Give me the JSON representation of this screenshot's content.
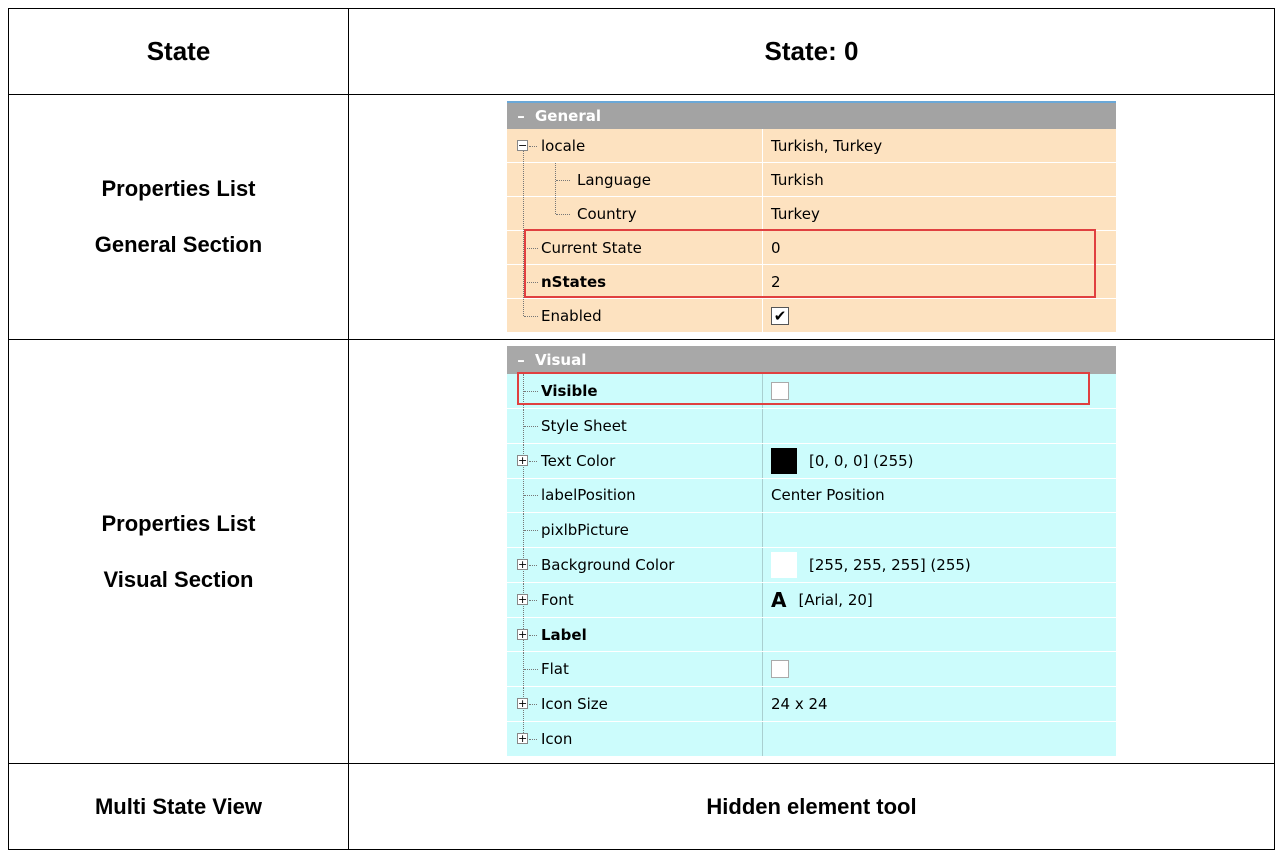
{
  "header": {
    "left": "State",
    "right": "State: 0"
  },
  "rows": [
    {
      "label_line1": "Properties List",
      "label_line2": "General Section"
    },
    {
      "label_line1": "Properties List",
      "label_line2": "Visual Section"
    }
  ],
  "footer": {
    "left": "Multi State View",
    "right": "Hidden element tool"
  },
  "general": {
    "title": "General",
    "items": [
      {
        "name": "locale",
        "value": "Turkish, Turkey"
      },
      {
        "name": "Language",
        "value": "Turkish"
      },
      {
        "name": "Country",
        "value": "Turkey"
      },
      {
        "name": "Current State",
        "value": "0"
      },
      {
        "name": "nStates",
        "value": "2"
      },
      {
        "name": "Enabled",
        "value": "",
        "checked": true
      }
    ]
  },
  "visual": {
    "title": "Visual",
    "items": [
      {
        "name": "Visible",
        "value": "",
        "checked": false
      },
      {
        "name": "Style Sheet",
        "value": ""
      },
      {
        "name": "Text Color",
        "value": "[0, 0, 0] (255)",
        "swatch": "#000000"
      },
      {
        "name": "labelPosition",
        "value": "Center Position"
      },
      {
        "name": "pixlbPicture",
        "value": ""
      },
      {
        "name": "Background Color",
        "value": "[255, 255, 255] (255)",
        "swatch": "#ffffff"
      },
      {
        "name": "Font",
        "value": "[Arial, 20]",
        "glyph": "A"
      },
      {
        "name": "Label",
        "value": ""
      },
      {
        "name": "Flat",
        "value": "",
        "checked": false
      },
      {
        "name": "Icon Size",
        "value": "24 x 24"
      },
      {
        "name": "Icon",
        "value": ""
      }
    ]
  },
  "colors": {
    "highlight": "#e04040",
    "general_row": "#fde2c0",
    "visual_row": "#ccfcfc",
    "section_header": "#a3a3a3"
  }
}
